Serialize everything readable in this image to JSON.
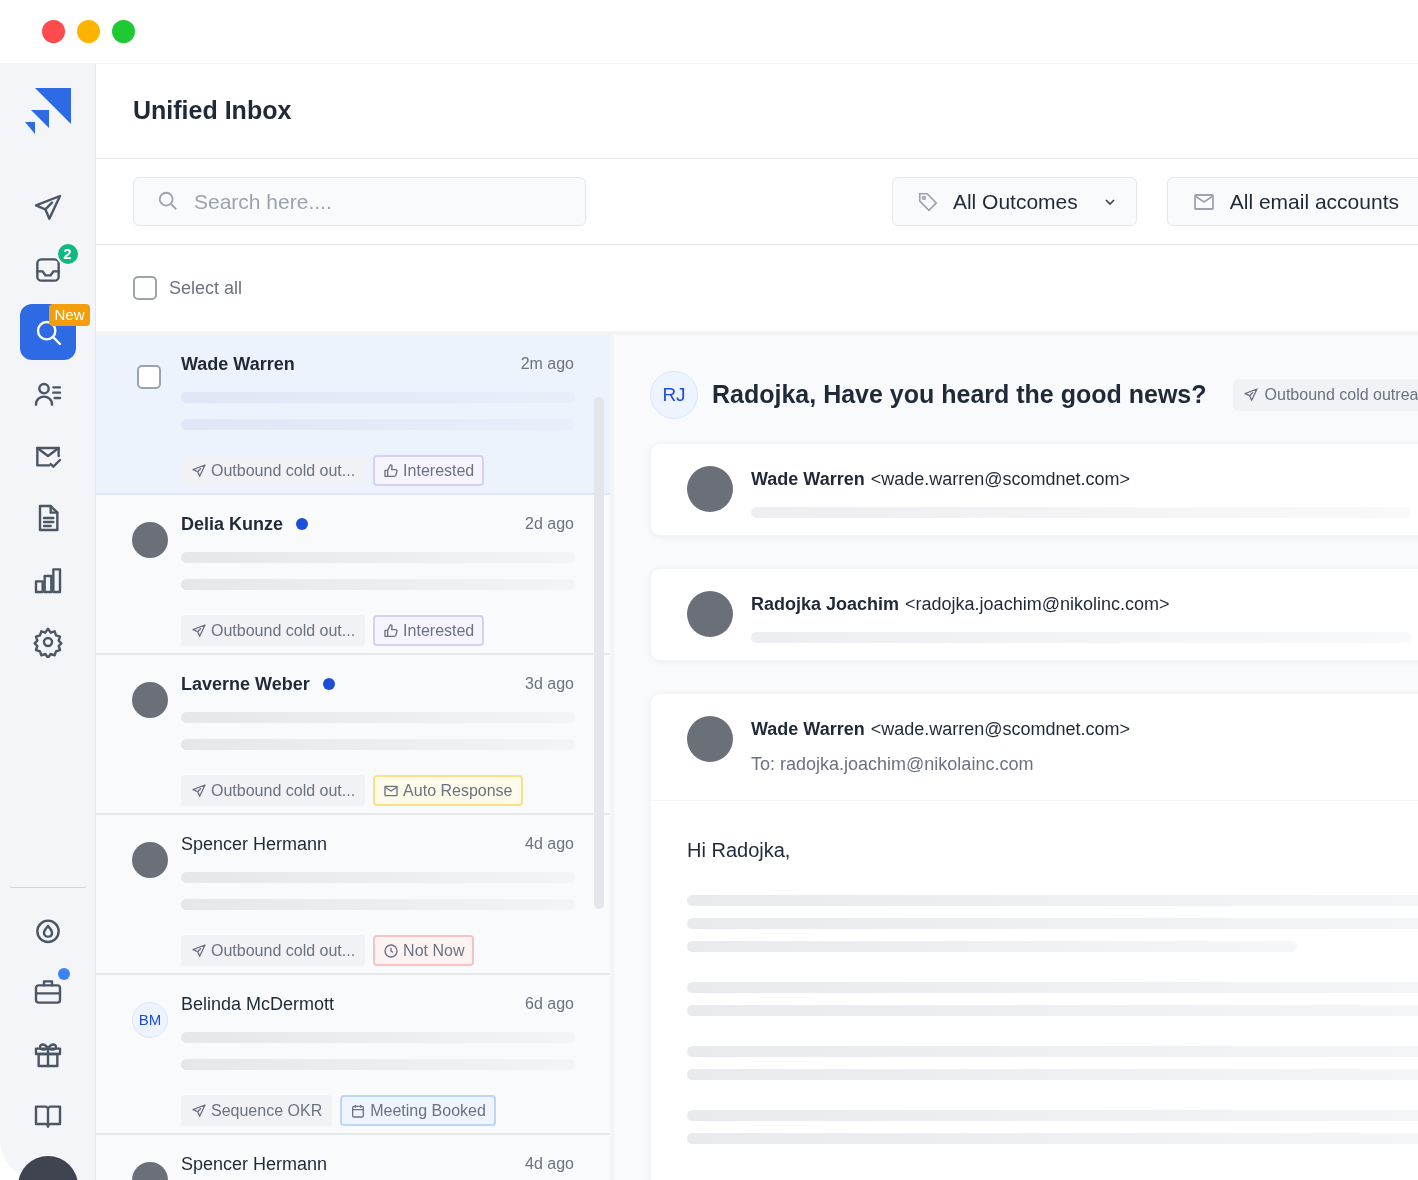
{
  "header": {
    "title": "Unified Inbox"
  },
  "sidebar": {
    "items": [
      {
        "selected": false,
        "notify_dot": false
      },
      {
        "selected": false,
        "notify_dot": false,
        "badge": {
          "label": "2",
          "kind": "count"
        }
      },
      {
        "selected": true,
        "notify_dot": false,
        "badge": {
          "label": "New",
          "kind": "new"
        }
      },
      {
        "selected": false,
        "notify_dot": false
      },
      {
        "selected": false,
        "notify_dot": false
      },
      {
        "selected": false,
        "notify_dot": false
      },
      {
        "selected": false,
        "notify_dot": false
      },
      {
        "selected": false,
        "notify_dot": false
      }
    ],
    "bottom_items": [
      {
        "selected": false,
        "notify_dot": false
      },
      {
        "selected": false,
        "notify_dot": true
      },
      {
        "selected": false,
        "notify_dot": false
      },
      {
        "selected": false,
        "notify_dot": false
      }
    ]
  },
  "toolbar": {
    "search": {
      "placeholder": "Search here...."
    },
    "filters": [
      {
        "label": "All Outcomes",
        "kind": "tag"
      },
      {
        "label": "All email accounts",
        "kind": "mail"
      }
    ]
  },
  "select_all": {
    "label": "Select all",
    "checked": false
  },
  "messages": [
    {
      "name": "Wade Warren",
      "time": "2m ago",
      "selected": true,
      "unread": true,
      "new_dot": false,
      "avatar": {
        "kind": "checkbox",
        "checked": false
      },
      "sequence": "Outbound cold out...",
      "outcome": {
        "label": "Interested",
        "kind": "interested"
      }
    },
    {
      "name": "Delia Kunze",
      "time": "2d ago",
      "selected": false,
      "unread": true,
      "new_dot": true,
      "avatar": {
        "kind": "photo"
      },
      "sequence": "Outbound cold out...",
      "outcome": {
        "label": "Interested",
        "kind": "interested"
      }
    },
    {
      "name": "Laverne Weber",
      "time": "3d ago",
      "selected": false,
      "unread": true,
      "new_dot": true,
      "avatar": {
        "kind": "photo"
      },
      "sequence": "Outbound cold out...",
      "outcome": {
        "label": "Auto Response",
        "kind": "auto_response"
      }
    },
    {
      "name": "Spencer Hermann",
      "time": "4d ago",
      "selected": false,
      "unread": false,
      "new_dot": false,
      "avatar": {
        "kind": "photo"
      },
      "sequence": "Outbound cold out...",
      "outcome": {
        "label": "Not Now",
        "kind": "not_now"
      }
    },
    {
      "name": "Belinda McDermott",
      "time": "6d ago",
      "selected": false,
      "unread": false,
      "new_dot": false,
      "avatar": {
        "kind": "initials",
        "text": "BM"
      },
      "sequence": "Sequence OKR",
      "outcome": {
        "label": "Meeting Booked",
        "kind": "meeting_booked"
      }
    },
    {
      "name": "Spencer Hermann",
      "time": "4d ago",
      "selected": false,
      "unread": false,
      "new_dot": false,
      "avatar": {
        "kind": "photo"
      }
    }
  ],
  "thread": {
    "initials": "RJ",
    "subject": "Radojka, Have you heard the good news?",
    "sequence": "Outbound cold outrea",
    "emails": [
      {
        "sender": "Wade Warren",
        "address": "<wade.warren@scomdnet.com>",
        "expanded": false
      },
      {
        "sender": "Radojka Joachim",
        "address": "<radojka.joachim@nikolinc.com>",
        "expanded": false
      },
      {
        "sender": "Wade Warren",
        "address": "<wade.warren@scomdnet.com>",
        "expanded": true,
        "to": "To: radojka.joachim@nikolainc.com",
        "greeting": "Hi Radojka,"
      }
    ]
  }
}
